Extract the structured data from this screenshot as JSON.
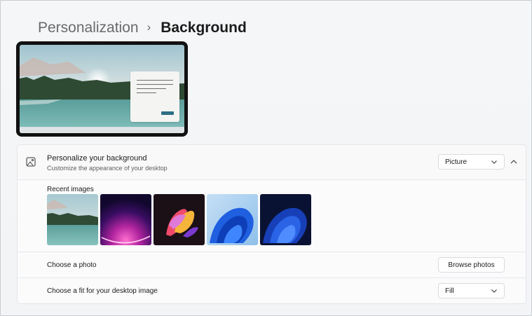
{
  "breadcrumb": {
    "parent": "Personalization",
    "separator": "›",
    "current": "Background"
  },
  "personalize": {
    "title": "Personalize your background",
    "subtitle": "Customize the appearance of your desktop",
    "type_value": "Picture",
    "icon": "image-icon",
    "expand_icon": "chevron-up-icon"
  },
  "recent_images": {
    "label": "Recent images",
    "items": [
      "lake-landscape",
      "purple-glow",
      "colorful-ribbons",
      "blue-bloom-light",
      "blue-bloom-dark"
    ]
  },
  "choose_photo": {
    "label": "Choose a photo",
    "button": "Browse photos"
  },
  "choose_fit": {
    "label": "Choose a fit for your desktop image",
    "value": "Fill"
  },
  "colors": {
    "accent": "#2e6d86",
    "card_bg": "#fbfbfc",
    "page_bg": "#f3f5f7"
  }
}
